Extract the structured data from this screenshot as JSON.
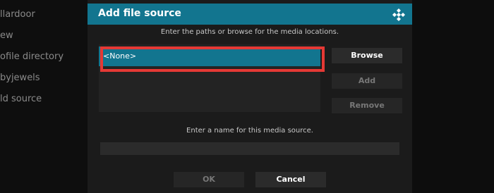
{
  "background_menu": {
    "items": [
      "llardoor",
      "ew",
      "ofile directory",
      "byjewels",
      "ld source"
    ]
  },
  "dialog": {
    "title": "Add file source",
    "logo_icon": "kodi-logo-icon",
    "paths_instruction": "Enter the paths or browse for the media locations.",
    "paths": [
      "<None>"
    ],
    "buttons": {
      "browse": "Browse",
      "add": "Add",
      "remove": "Remove"
    },
    "name_instruction": "Enter a name for this media source.",
    "name_value": "",
    "ok": "OK",
    "cancel": "Cancel"
  },
  "colors": {
    "accent": "#12758f",
    "highlight_border": "#e53935",
    "dialog_bg": "#1b1b1b"
  }
}
